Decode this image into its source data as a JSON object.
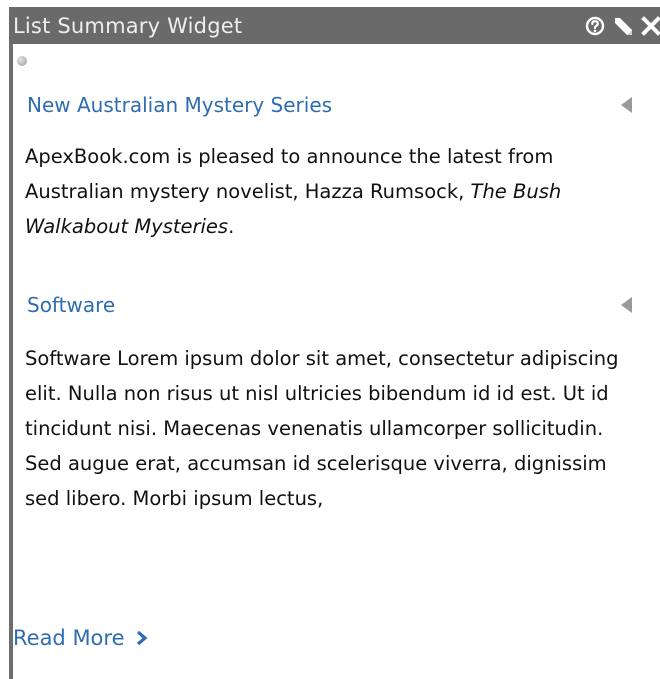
{
  "widget": {
    "title": "List Summary Widget",
    "icons": {
      "help": "help-icon",
      "edit": "pencil-icon",
      "close": "close-icon"
    }
  },
  "items": [
    {
      "title": "New Australian Mystery Series",
      "body_prefix": "ApexBook.com is pleased to announce the latest from Australian mystery novelist, Hazza Rumsock, ",
      "body_italic": "The Bush Walkabout Mysteries",
      "body_suffix": "."
    },
    {
      "title": "Software",
      "body": "Software Lorem ipsum dolor sit amet, consectetur adipiscing elit. Nulla non risus ut nisl ultricies bibendum id id est. Ut id tincidunt nisi. Maecenas venenatis ullamcorper sollicitudin. Sed augue erat, accumsan id scelerisque viverra, dignissim sed libero. Morbi ipsum lectus,"
    }
  ],
  "read_more": "Read More",
  "colors": {
    "titlebar": "#6a6a6a",
    "link": "#2f6db0",
    "text": "#111111"
  }
}
